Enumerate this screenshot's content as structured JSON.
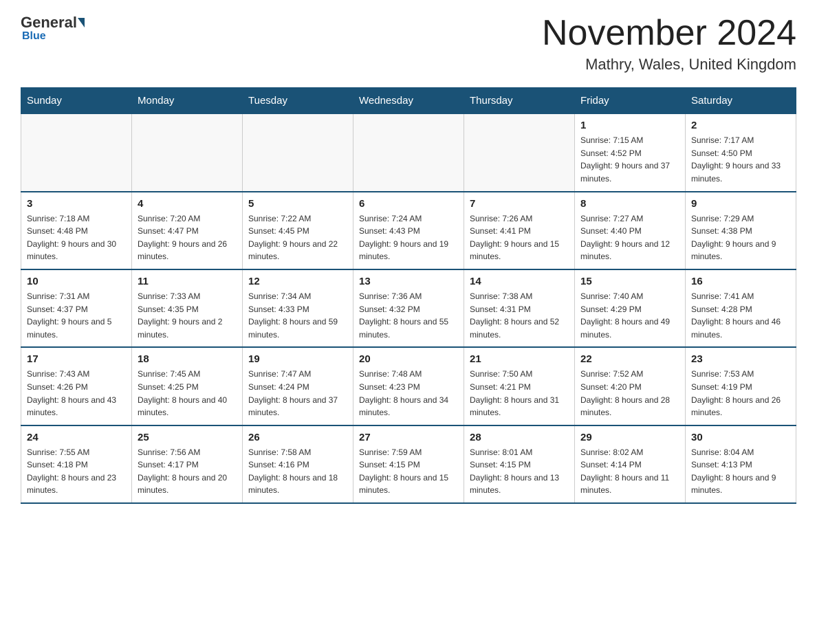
{
  "header": {
    "logo": {
      "general": "General",
      "blue": "Blue"
    },
    "title": "November 2024",
    "location": "Mathry, Wales, United Kingdom"
  },
  "weekdays": [
    "Sunday",
    "Monday",
    "Tuesday",
    "Wednesday",
    "Thursday",
    "Friday",
    "Saturday"
  ],
  "weeks": [
    [
      {
        "day": "",
        "info": ""
      },
      {
        "day": "",
        "info": ""
      },
      {
        "day": "",
        "info": ""
      },
      {
        "day": "",
        "info": ""
      },
      {
        "day": "",
        "info": ""
      },
      {
        "day": "1",
        "info": "Sunrise: 7:15 AM\nSunset: 4:52 PM\nDaylight: 9 hours and 37 minutes."
      },
      {
        "day": "2",
        "info": "Sunrise: 7:17 AM\nSunset: 4:50 PM\nDaylight: 9 hours and 33 minutes."
      }
    ],
    [
      {
        "day": "3",
        "info": "Sunrise: 7:18 AM\nSunset: 4:48 PM\nDaylight: 9 hours and 30 minutes."
      },
      {
        "day": "4",
        "info": "Sunrise: 7:20 AM\nSunset: 4:47 PM\nDaylight: 9 hours and 26 minutes."
      },
      {
        "day": "5",
        "info": "Sunrise: 7:22 AM\nSunset: 4:45 PM\nDaylight: 9 hours and 22 minutes."
      },
      {
        "day": "6",
        "info": "Sunrise: 7:24 AM\nSunset: 4:43 PM\nDaylight: 9 hours and 19 minutes."
      },
      {
        "day": "7",
        "info": "Sunrise: 7:26 AM\nSunset: 4:41 PM\nDaylight: 9 hours and 15 minutes."
      },
      {
        "day": "8",
        "info": "Sunrise: 7:27 AM\nSunset: 4:40 PM\nDaylight: 9 hours and 12 minutes."
      },
      {
        "day": "9",
        "info": "Sunrise: 7:29 AM\nSunset: 4:38 PM\nDaylight: 9 hours and 9 minutes."
      }
    ],
    [
      {
        "day": "10",
        "info": "Sunrise: 7:31 AM\nSunset: 4:37 PM\nDaylight: 9 hours and 5 minutes."
      },
      {
        "day": "11",
        "info": "Sunrise: 7:33 AM\nSunset: 4:35 PM\nDaylight: 9 hours and 2 minutes."
      },
      {
        "day": "12",
        "info": "Sunrise: 7:34 AM\nSunset: 4:33 PM\nDaylight: 8 hours and 59 minutes."
      },
      {
        "day": "13",
        "info": "Sunrise: 7:36 AM\nSunset: 4:32 PM\nDaylight: 8 hours and 55 minutes."
      },
      {
        "day": "14",
        "info": "Sunrise: 7:38 AM\nSunset: 4:31 PM\nDaylight: 8 hours and 52 minutes."
      },
      {
        "day": "15",
        "info": "Sunrise: 7:40 AM\nSunset: 4:29 PM\nDaylight: 8 hours and 49 minutes."
      },
      {
        "day": "16",
        "info": "Sunrise: 7:41 AM\nSunset: 4:28 PM\nDaylight: 8 hours and 46 minutes."
      }
    ],
    [
      {
        "day": "17",
        "info": "Sunrise: 7:43 AM\nSunset: 4:26 PM\nDaylight: 8 hours and 43 minutes."
      },
      {
        "day": "18",
        "info": "Sunrise: 7:45 AM\nSunset: 4:25 PM\nDaylight: 8 hours and 40 minutes."
      },
      {
        "day": "19",
        "info": "Sunrise: 7:47 AM\nSunset: 4:24 PM\nDaylight: 8 hours and 37 minutes."
      },
      {
        "day": "20",
        "info": "Sunrise: 7:48 AM\nSunset: 4:23 PM\nDaylight: 8 hours and 34 minutes."
      },
      {
        "day": "21",
        "info": "Sunrise: 7:50 AM\nSunset: 4:21 PM\nDaylight: 8 hours and 31 minutes."
      },
      {
        "day": "22",
        "info": "Sunrise: 7:52 AM\nSunset: 4:20 PM\nDaylight: 8 hours and 28 minutes."
      },
      {
        "day": "23",
        "info": "Sunrise: 7:53 AM\nSunset: 4:19 PM\nDaylight: 8 hours and 26 minutes."
      }
    ],
    [
      {
        "day": "24",
        "info": "Sunrise: 7:55 AM\nSunset: 4:18 PM\nDaylight: 8 hours and 23 minutes."
      },
      {
        "day": "25",
        "info": "Sunrise: 7:56 AM\nSunset: 4:17 PM\nDaylight: 8 hours and 20 minutes."
      },
      {
        "day": "26",
        "info": "Sunrise: 7:58 AM\nSunset: 4:16 PM\nDaylight: 8 hours and 18 minutes."
      },
      {
        "day": "27",
        "info": "Sunrise: 7:59 AM\nSunset: 4:15 PM\nDaylight: 8 hours and 15 minutes."
      },
      {
        "day": "28",
        "info": "Sunrise: 8:01 AM\nSunset: 4:15 PM\nDaylight: 8 hours and 13 minutes."
      },
      {
        "day": "29",
        "info": "Sunrise: 8:02 AM\nSunset: 4:14 PM\nDaylight: 8 hours and 11 minutes."
      },
      {
        "day": "30",
        "info": "Sunrise: 8:04 AM\nSunset: 4:13 PM\nDaylight: 8 hours and 9 minutes."
      }
    ]
  ]
}
